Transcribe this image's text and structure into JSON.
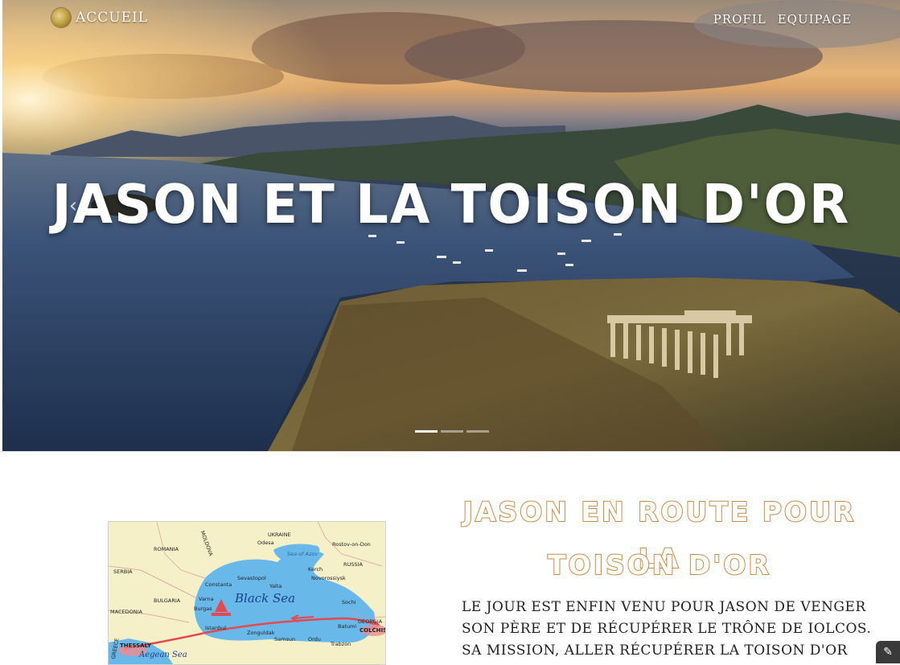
{
  "nav": {
    "home_label": "Accueil",
    "links": [
      "Profil",
      "Equipage"
    ]
  },
  "hero": {
    "title": "Jason et la Toison d'Or",
    "prev_icon": "‹",
    "next_icon": "›",
    "slide_count": 3,
    "active_slide": 1
  },
  "section": {
    "title_line1": "Jason en route pour la",
    "title_line2": "Toison d'Or",
    "title_color": "#c98b45",
    "paragraph_lines": [
      "Le jour est enfin venu pour Jason de venger",
      "son père et de récupérer le trône de Iolcos.",
      "Sa mission, aller récupérer la toison d'or"
    ]
  },
  "map": {
    "sea_label": "Black Sea",
    "aegean_label": "Aegean Sea",
    "countries": [
      "ROMANIA",
      "UKRAINE",
      "MOLDOVA",
      "RUSSIA",
      "SERBIA",
      "BULGARIA",
      "MACEDONIA",
      "GREECE",
      "GEORGIA",
      "Sea of Azov"
    ],
    "cities": [
      "Odesa",
      "Rostov-on-Don",
      "Kerch",
      "Sevastopol",
      "Yalta",
      "Novorossiysk",
      "Constanta",
      "Varna",
      "Burgas",
      "Istanbul",
      "Zonguldak",
      "Samsun",
      "Ordu",
      "Trabzon",
      "Batumi",
      "Sochi"
    ],
    "start_label": "THESSALY",
    "end_label": "COLCHIS",
    "route_color": "#e5484d"
  },
  "icons": {
    "logo": "gold-coin-icon",
    "prev": "chevron-left-icon",
    "next": "chevron-right-icon",
    "corner": "widget-icon"
  }
}
